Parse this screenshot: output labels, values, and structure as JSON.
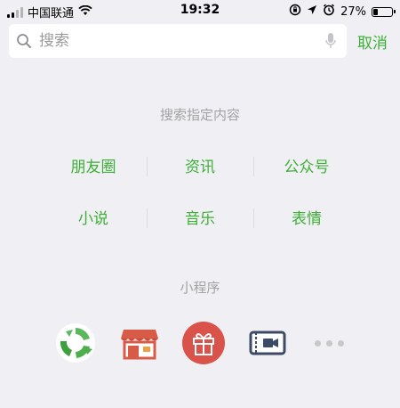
{
  "status_bar": {
    "carrier": "中国联通",
    "time": "19:32",
    "battery_percent": "27%",
    "battery_level": 0.27,
    "icons": [
      "signal-icon",
      "wifi-icon",
      "rotation-lock-icon",
      "location-icon",
      "alarm-icon",
      "battery-icon"
    ]
  },
  "search": {
    "placeholder": "搜索",
    "cancel_label": "取消"
  },
  "specify_section": {
    "title": "搜索指定内容",
    "rows": [
      [
        "朋友圈",
        "资讯",
        "公众号"
      ],
      [
        "小说",
        "音乐",
        "表情"
      ]
    ]
  },
  "mini_programs": {
    "title": "小程序",
    "apps": [
      "recycle-app-icon",
      "store-app-icon",
      "gift-app-icon",
      "ticket-app-icon"
    ],
    "more_icon": "more-dots-icon"
  },
  "colors": {
    "accent": "#3cb034",
    "background": "#efeff4",
    "muted_text": "#a3a3a3",
    "gift_red": "#d9534a",
    "store_red": "#d85b48"
  }
}
